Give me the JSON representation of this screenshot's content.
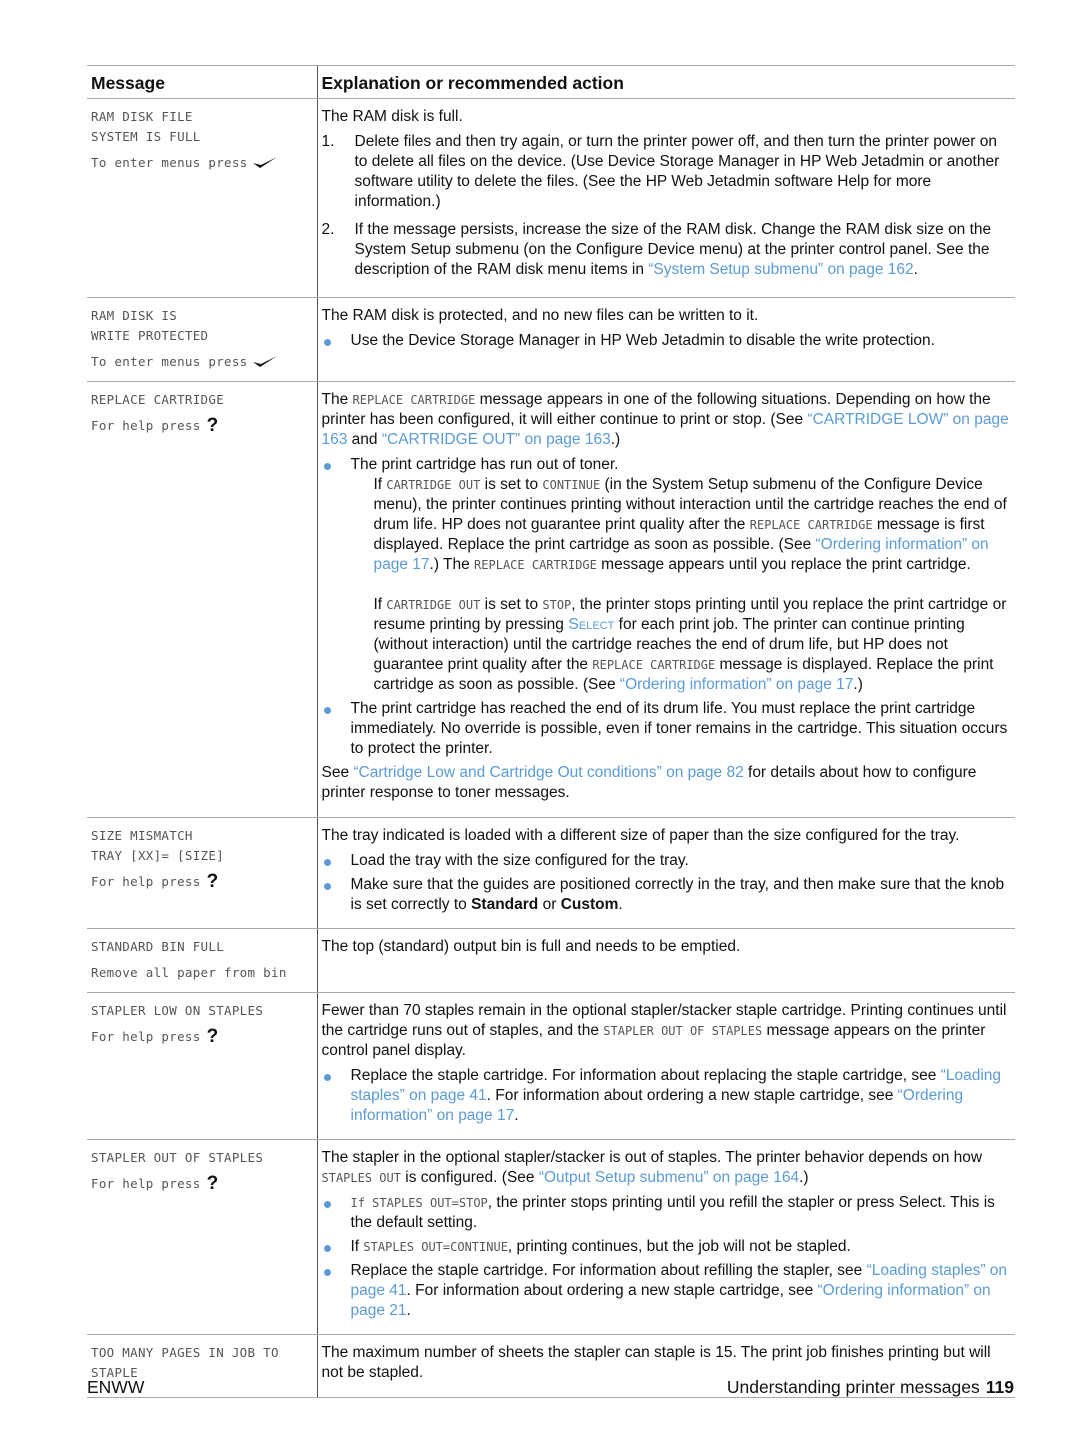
{
  "table": {
    "headers": {
      "message": "Message",
      "explanation": "Explanation or recommended action"
    },
    "rows": {
      "ram_full": {
        "lcd": [
          "RAM DISK FILE",
          "SYSTEM IS FULL"
        ],
        "prompt": "To enter menus press",
        "prompt_icon": "checkmark-icon",
        "intro": "The RAM disk is full.",
        "steps": [
          {
            "num": "1.",
            "text": "Delete files and then try again, or turn the printer power off, and then turn the printer power on to delete all files on the device. (Use Device Storage Manager in HP Web Jetadmin or another software utility to delete the files. (See the HP Web Jetadmin software Help for more information.)"
          },
          {
            "num": "2.",
            "text": "If the message persists, increase the size of the RAM disk. Change the RAM disk size on the System Setup submenu (on the Configure Device menu) at the printer control panel. See the description of the RAM disk menu items in ",
            "link": "“System Setup submenu” on page 162",
            "tail": "."
          }
        ]
      },
      "ram_protected": {
        "lcd": [
          "RAM DISK IS",
          "WRITE PROTECTED"
        ],
        "prompt": "To enter menus press",
        "prompt_icon": "checkmark-icon",
        "intro": "The RAM disk is protected, and no new files can be written to it.",
        "bullets": [
          "Use the Device Storage Manager in HP Web Jetadmin to disable the write protection."
        ]
      },
      "replace_cartridge": {
        "lcd": [
          "REPLACE CARTRIDGE"
        ],
        "prompt": "For help press",
        "prompt_icon": "question-mark-icon",
        "intro_a": "The ",
        "intro_code": "REPLACE CARTRIDGE",
        "intro_b": " message appears in one of the following situations. Depending on how the printer has been configured, it will either continue to print or stop. (See ",
        "intro_link1": "“CARTRIDGE LOW” on page 163",
        "intro_and": " and ",
        "intro_link2": "“CARTRIDGE OUT” on page 163",
        "intro_end": ".)",
        "bullet1": "The print cartridge has run out of toner.",
        "sub1": {
          "a": "If ",
          "code1": "CARTRIDGE OUT",
          "b": " is set to ",
          "code2": "CONTINUE",
          "c": " (in the System Setup submenu of the Configure Device menu), the printer continues printing without interaction until the cartridge reaches the end of drum life. HP does not guarantee print quality after the ",
          "code3": "REPLACE CARTRIDGE",
          "d": " message is first displayed. Replace the print cartridge as soon as possible. (See ",
          "link": "“Ordering information” on page 17",
          "e": ".) The ",
          "code4": "REPLACE CARTRIDGE",
          "f": " message appears until you replace the print cartridge."
        },
        "sub2": {
          "a": "If ",
          "code1": "CARTRIDGE OUT",
          "b": " is set to ",
          "code2": "STOP",
          "c": ", the printer stops printing until you replace the print cartridge or resume printing by pressing ",
          "select": "Select",
          "d": " for each print job. The printer can continue printing (without interaction) until the cartridge reaches the end of drum life, but HP does not guarantee print quality after the ",
          "code3": "REPLACE CARTRIDGE",
          "e": " message is displayed. Replace the print cartridge as soon as possible. (See ",
          "link": "“Ordering information” on page 17",
          "f": ".)"
        },
        "bullet2": "The print cartridge has reached the end of its drum life. You must replace the print cartridge immediately. No override is possible, even if toner remains in the cartridge. This situation occurs to protect the printer.",
        "outro_a": "See ",
        "outro_link": "“Cartridge Low and Cartridge Out conditions” on page 82",
        "outro_b": " for details about how to configure printer response to toner messages."
      },
      "size_mismatch": {
        "lcd": [
          "SIZE MISMATCH",
          "TRAY [XX]= [SIZE]"
        ],
        "prompt": "For help press",
        "prompt_icon": "question-mark-icon",
        "intro": "The tray indicated is loaded with a different size of paper than the size configured for the tray.",
        "bullet1": "Load the tray with the size configured for the tray.",
        "bullet2_a": "Make sure that the guides are positioned correctly in the tray, and then make sure that the knob is set correctly to ",
        "bullet2_b1": "Standard",
        "bullet2_or": " or ",
        "bullet2_b2": "Custom",
        "bullet2_end": "."
      },
      "bin_full": {
        "lcd": [
          "STANDARD BIN FULL"
        ],
        "prompt": "Remove all paper from bin",
        "intro": "The top (standard) output bin is full and needs to be emptied."
      },
      "stapler_low": {
        "lcd": [
          "STAPLER LOW ON STAPLES"
        ],
        "prompt": "For help press",
        "prompt_icon": "question-mark-icon",
        "intro_a": "Fewer than 70 staples remain in the optional stapler/stacker staple cartridge. Printing continues until the cartridge runs out of staples, and the ",
        "intro_code": "STAPLER OUT OF STAPLES",
        "intro_b": " message appears on the printer control panel display.",
        "bullet_a": "Replace the staple cartridge. For information about replacing the staple cartridge, see ",
        "bullet_link1": "“Loading staples” on page 41",
        "bullet_b": ". For information about ordering a new staple cartridge, see ",
        "bullet_link2": "“Ordering information” on page 17",
        "bullet_end": "."
      },
      "stapler_out": {
        "lcd": [
          "STAPLER OUT OF STAPLES"
        ],
        "prompt": "For help press",
        "prompt_icon": "question-mark-icon",
        "intro_a": "The stapler in the optional stapler/stacker is out of staples. The printer behavior depends on how ",
        "intro_code": "STAPLES OUT",
        "intro_b": " is configured. (See ",
        "intro_link": "“Output Setup submenu” on page 164",
        "intro_end": ".)",
        "bullet1_code": "If STAPLES OUT=STOP",
        "bullet1_text": ", the printer stops printing until you refill the stapler or press Select. This is the default setting.",
        "bullet2_a": "If ",
        "bullet2_code": "STAPLES OUT=CONTINUE",
        "bullet2_b": ", printing continues, but the job will not be stapled.",
        "bullet3_a": "Replace the staple cartridge. For information about refilling the stapler, see ",
        "bullet3_link1": "“Loading staples” on page 41",
        "bullet3_b": ". For information about ordering a new staple cartridge, see ",
        "bullet3_link2": "“Ordering information” on page 21",
        "bullet3_end": "."
      },
      "too_many_pages": {
        "lcd": [
          "TOO MANY PAGES IN JOB TO",
          "STAPLE"
        ],
        "intro": "The maximum number of sheets the stapler can staple is 15. The print job finishes printing but will not be stapled."
      }
    }
  },
  "footer": {
    "left": "ENWW",
    "section": "Understanding printer messages",
    "page_number": "119"
  },
  "colors": {
    "link": "#5b9bd5",
    "bullet": "#5b9bd5",
    "lcd_text": "#555555",
    "rule": "#a8a8a8"
  }
}
